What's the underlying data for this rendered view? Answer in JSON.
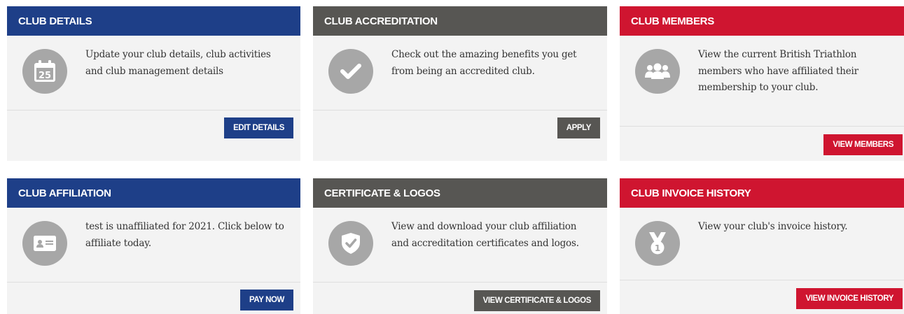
{
  "colors": {
    "blue": "#1e3f88",
    "grey": "#575653",
    "red": "#cf1530",
    "icon_circle": "#a7a7a7",
    "card_background": "#f3f3f3"
  },
  "cards": [
    {
      "title": "CLUB DETAILS",
      "text": "Update your club details, club activities and club management details",
      "button": "EDIT DETAILS",
      "icon": "calendar-icon",
      "icon_text": "25"
    },
    {
      "title": "CLUB ACCREDITATION",
      "text": "Check out the amazing benefits you get from being an accredited club.",
      "button": "APPLY",
      "icon": "checkmark-icon"
    },
    {
      "title": "CLUB MEMBERS",
      "text": "View the current British Triathlon members who have affiliated their membership to your club.",
      "button": "VIEW MEMBERS",
      "icon": "members-icon"
    },
    {
      "title": "CLUB AFFILIATION",
      "text": "test is unaffiliated for 2021. Click below to affiliate today.",
      "button": "PAY NOW",
      "icon": "id-card-icon"
    },
    {
      "title": "CERTIFICATE & LOGOS",
      "text": "View and download your club affiliation and accreditation certificates and logos.",
      "button": "VIEW CERTIFICATE & LOGOS",
      "icon": "shield-check-icon"
    },
    {
      "title": "CLUB INVOICE HISTORY",
      "text": "View your club's invoice history.",
      "button": "VIEW INVOICE HISTORY",
      "icon": "medal-icon",
      "icon_text": "1"
    }
  ]
}
